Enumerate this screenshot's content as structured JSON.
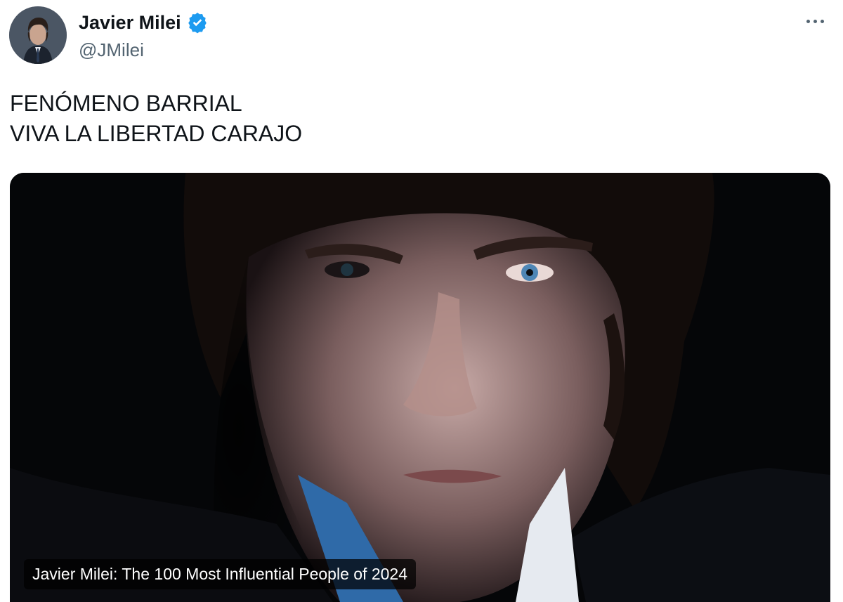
{
  "author": {
    "display_name": "Javier Milei",
    "handle": "@JMilei",
    "verified": true,
    "verified_icon": "verified-badge-icon",
    "verified_color": "#1d9bf0"
  },
  "menu": {
    "more_icon": "more-horizontal-icon"
  },
  "tweet": {
    "lines": [
      "FENÓMENO BARRIAL",
      "VIVA LA LIBERTAD CARAJO"
    ]
  },
  "media": {
    "caption": "Javier Milei: The 100 Most Influential People of 2024"
  },
  "colors": {
    "text": "#0f1419",
    "secondary": "#536471",
    "media_background": "#050608"
  }
}
